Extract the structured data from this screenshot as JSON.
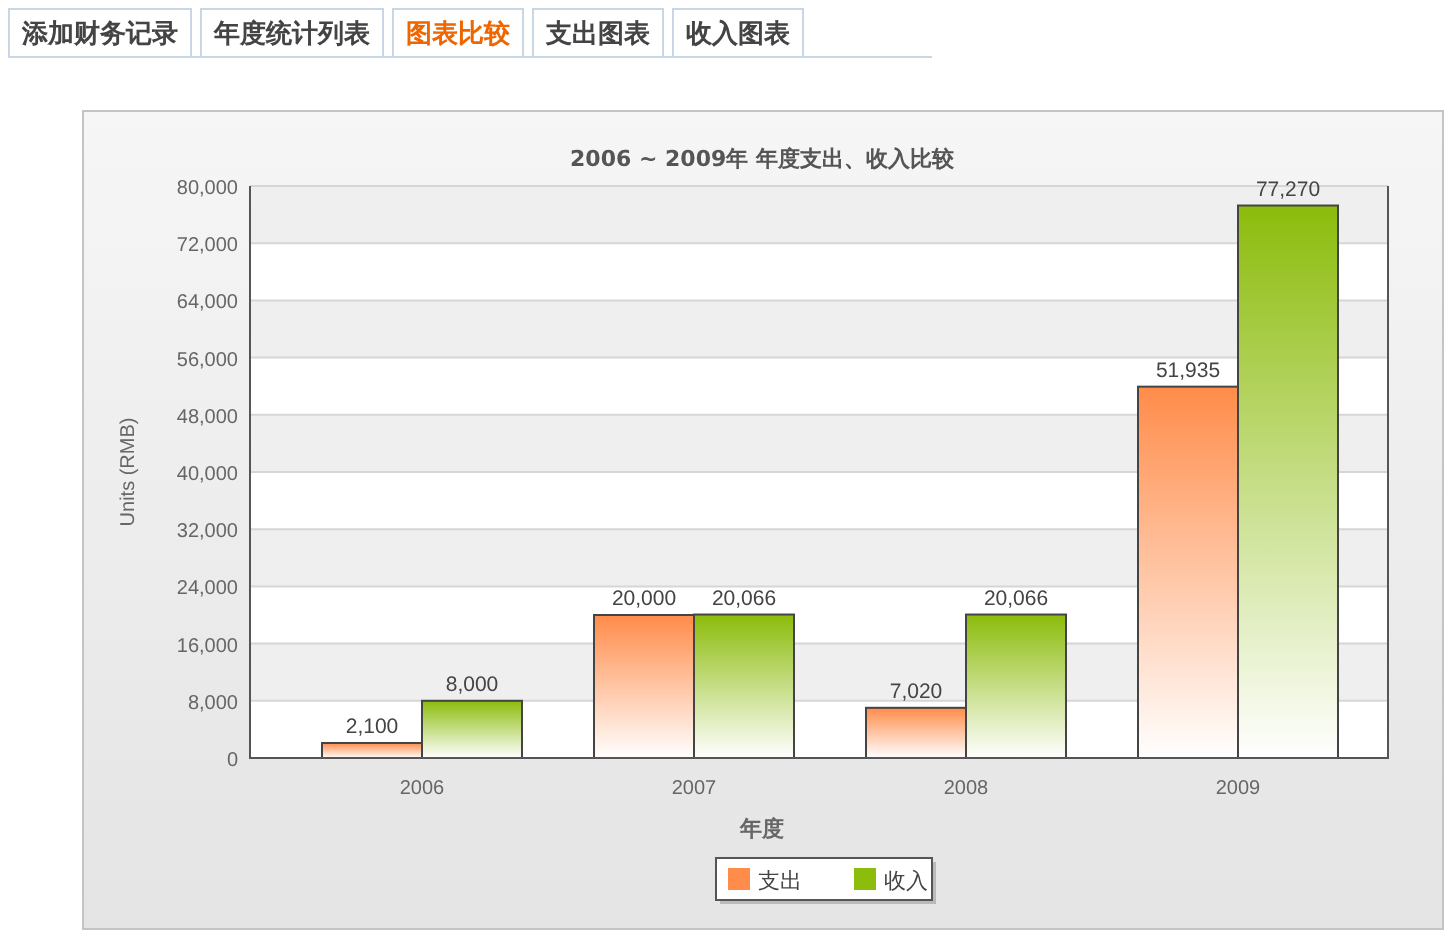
{
  "tabs": [
    {
      "label": "添加财务记录",
      "selected": false
    },
    {
      "label": "年度统计列表",
      "selected": false
    },
    {
      "label": "图表比较",
      "selected": true
    },
    {
      "label": "支出图表",
      "selected": false
    },
    {
      "label": "收入图表",
      "selected": false
    }
  ],
  "chart": {
    "chart_data": {
      "type": "bar",
      "title": "2006 ~ 2009年 年度支出、收入比较",
      "xlabel": "年度",
      "ylabel": "Units (RMB)",
      "categories": [
        "2006",
        "2007",
        "2008",
        "2009"
      ],
      "series": [
        {
          "name": "支出",
          "color": "#ff8c4a",
          "values": [
            2100,
            20000,
            7020,
            51935
          ],
          "value_labels": [
            "2,100",
            "20,000",
            "7,020",
            "51,935"
          ]
        },
        {
          "name": "收入",
          "color": "#8cbc0c",
          "values": [
            8000,
            20066,
            20066,
            77270
          ],
          "value_labels": [
            "8,000",
            "20,066",
            "20,066",
            "77,270"
          ]
        }
      ],
      "ylim": [
        0,
        80000
      ],
      "yticks": [
        {
          "value": 0,
          "label": "0"
        },
        {
          "value": 8000,
          "label": "8,000"
        },
        {
          "value": 16000,
          "label": "16,000"
        },
        {
          "value": 24000,
          "label": "24,000"
        },
        {
          "value": 32000,
          "label": "32,000"
        },
        {
          "value": 40000,
          "label": "40,000"
        },
        {
          "value": 48000,
          "label": "48,000"
        },
        {
          "value": 56000,
          "label": "56,000"
        },
        {
          "value": 64000,
          "label": "64,000"
        },
        {
          "value": 72000,
          "label": "72,000"
        },
        {
          "value": 80000,
          "label": "80,000"
        }
      ],
      "data_labels": true,
      "grid": true,
      "legend": true
    }
  }
}
